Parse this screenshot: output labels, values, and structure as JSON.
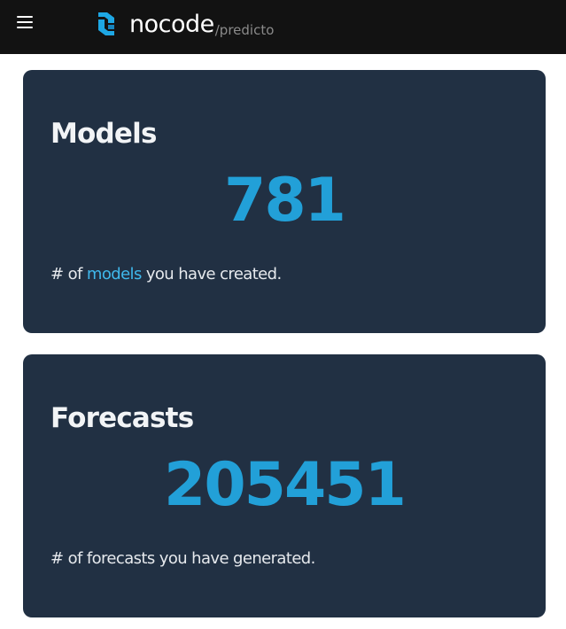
{
  "header": {
    "brand_name": "nocode",
    "brand_sub": "/predicto",
    "logo_icon": "nocode-logo-icon",
    "menu_icon": "hamburger-menu-icon",
    "brand_color": "#1ea7e4"
  },
  "cards": {
    "models": {
      "title": "Models",
      "value": "781",
      "desc_prefix": "# of ",
      "desc_link": "models",
      "desc_suffix": " you have created."
    },
    "forecasts": {
      "title": "Forecasts",
      "value": "205451",
      "desc": "# of forecasts you have generated."
    }
  },
  "colors": {
    "topbar_bg": "#121212",
    "card_bg": "#213043",
    "value_color": "#22a0d8",
    "link_color": "#3fb8ec"
  }
}
